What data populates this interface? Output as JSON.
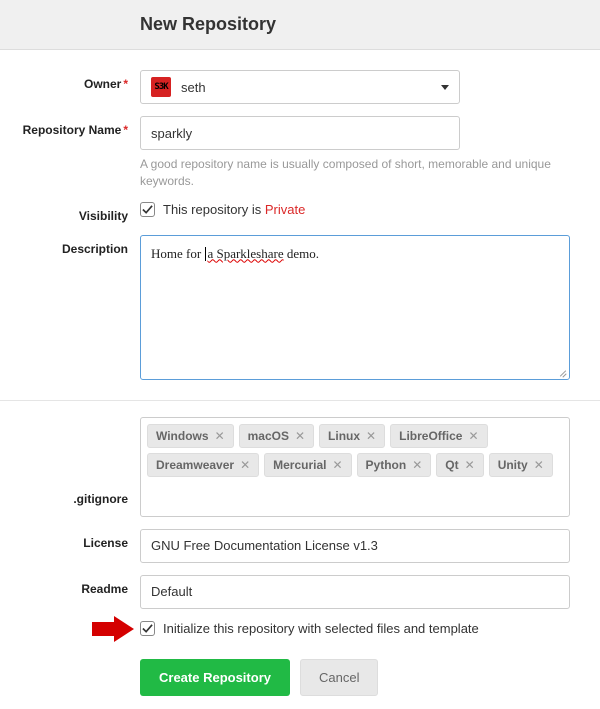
{
  "header": {
    "title": "New Repository"
  },
  "labels": {
    "owner": "Owner",
    "repoName": "Repository Name",
    "visibility": "Visibility",
    "description": "Description",
    "gitignore": ".gitignore",
    "license": "License",
    "readme": "Readme"
  },
  "owner": {
    "avatar": "S3K",
    "value": "seth"
  },
  "repoName": {
    "value": "sparkly"
  },
  "repoHint": "A good repository name is usually composed of short, memorable and unique keywords.",
  "visibility": {
    "checked": true,
    "label_prefix": "This repository is ",
    "label_suffix": "Private"
  },
  "description": {
    "pre": "Home for ",
    "mid": "a Sparkleshare",
    "post": " demo."
  },
  "gitignoreTags": [
    "Windows",
    "macOS",
    "Linux",
    "LibreOffice",
    "Dreamweaver",
    "Mercurial",
    "Python",
    "Qt",
    "Unity"
  ],
  "license": {
    "value": "GNU Free Documentation License v1.3"
  },
  "readme": {
    "value": "Default"
  },
  "init": {
    "checked": true,
    "label": "Initialize this repository with selected files and template"
  },
  "buttons": {
    "create": "Create Repository",
    "cancel": "Cancel"
  }
}
